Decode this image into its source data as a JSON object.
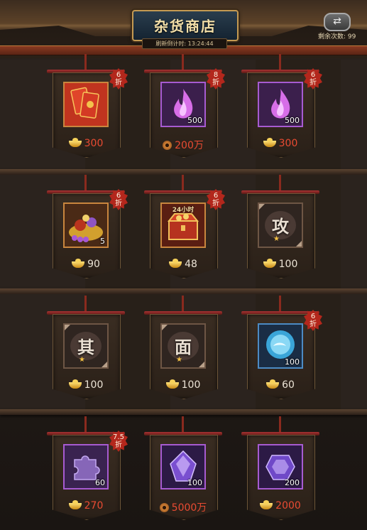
{
  "header": {
    "title": "杂货商店",
    "timer_label": "刷新倒计时: 13:24:44",
    "refresh_icon": "refresh-arrows-icon",
    "remaining_label": "剩余次数: 99"
  },
  "colors": {
    "discount_badge": "#b3271c",
    "price_red": "#e94b32",
    "price_white": "#ece4d6"
  },
  "items": [
    {
      "name": "red-envelope",
      "icon": "red-envelope-icon",
      "frame": "orange",
      "discount": [
        "6",
        "折"
      ],
      "qty": "",
      "price": "300",
      "currency": "gold-ingot-icon",
      "price_color": "red"
    },
    {
      "name": "purple-flame",
      "icon": "purple-flame-icon",
      "frame": "purple",
      "discount": [
        "8",
        "折"
      ],
      "qty": "500",
      "price": "200万",
      "currency": "copper-coin-icon",
      "price_color": "red"
    },
    {
      "name": "purple-flame",
      "icon": "purple-flame-icon",
      "frame": "purple",
      "discount": [
        "6",
        "折"
      ],
      "qty": "500",
      "price": "300",
      "currency": "gold-ingot-icon",
      "price_color": "red"
    },
    {
      "name": "treasure-pile",
      "icon": "treasure-pile-icon",
      "frame": "orange",
      "discount": [
        "6",
        "折"
      ],
      "qty": "5",
      "price": "90",
      "currency": "gold-ingot-icon",
      "price_color": "white"
    },
    {
      "name": "treasure-chest",
      "icon": "treasure-chest-icon",
      "frame": "orange",
      "discount": [
        "6",
        "折"
      ],
      "top_label": "24小时",
      "qty": "",
      "price": "48",
      "currency": "gold-ingot-icon",
      "price_color": "white"
    },
    {
      "name": "glyph-gong",
      "icon": "glyph-scroll-icon",
      "frame": "brown",
      "glyph": "攻",
      "qty": "",
      "price": "100",
      "currency": "gold-ingot-icon",
      "price_color": "white"
    },
    {
      "name": "glyph-qi",
      "icon": "glyph-scroll-icon",
      "frame": "brown",
      "glyph": "其",
      "qty": "",
      "price": "100",
      "currency": "gold-ingot-icon",
      "price_color": "white"
    },
    {
      "name": "glyph-mian",
      "icon": "glyph-scroll-icon",
      "frame": "brown",
      "glyph": "面",
      "qty": "",
      "price": "100",
      "currency": "gold-ingot-icon",
      "price_color": "white"
    },
    {
      "name": "blue-orb",
      "icon": "blue-orb-icon",
      "frame": "blue",
      "discount": [
        "6",
        "折"
      ],
      "qty": "100",
      "price": "60",
      "currency": "gold-ingot-icon",
      "price_color": "white"
    },
    {
      "name": "purple-puzzle",
      "icon": "puzzle-piece-icon",
      "frame": "purple",
      "discount": [
        "7.5",
        "折"
      ],
      "qty": "60",
      "price": "270",
      "currency": "gold-ingot-icon",
      "price_color": "red"
    },
    {
      "name": "purple-crystal",
      "icon": "purple-crystal-icon",
      "frame": "purple",
      "qty": "100",
      "price": "5000万",
      "currency": "copper-coin-icon",
      "price_color": "red"
    },
    {
      "name": "purple-gem",
      "icon": "purple-gem-icon",
      "frame": "purple",
      "qty": "200",
      "price": "2000",
      "currency": "gold-ingot-icon",
      "price_color": "red"
    }
  ]
}
